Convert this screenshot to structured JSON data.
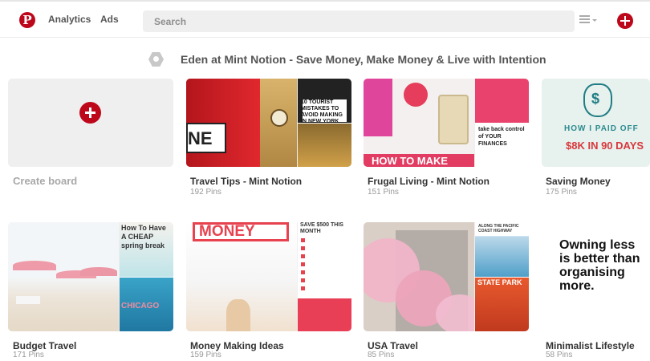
{
  "header": {
    "logo": "P",
    "nav": [
      "Analytics",
      "Ads"
    ],
    "search_placeholder": "Search"
  },
  "profile": {
    "title": "Eden at Mint Notion - Save Money, Make Money & Live with Intention"
  },
  "create_board": {
    "label": "Create board"
  },
  "boards": [
    {
      "title": "Travel Tips - Mint Notion",
      "count": "192 Pins",
      "cover": "NE",
      "side_top": "10 TOURIST MISTAKES TO AVOID MAKING IN NEW YORK CITY"
    },
    {
      "title": "Frugal Living - Mint Notion",
      "count": "151 Pins",
      "cover": "HOW TO MAKE",
      "side_bot": "take back control of YOUR FINANCES"
    },
    {
      "title": "Saving Money",
      "count": "175 Pins",
      "cover_line1": "HOW I PAID OFF",
      "cover_line2": "$8K IN 90 DAYS"
    },
    {
      "title": "Budget Travel",
      "count": "171 Pins",
      "side_top": "How To Have A CHEAP spring break",
      "side_bot": "CHICAGO"
    },
    {
      "title": "Money Making Ideas",
      "count": "159 Pins",
      "cover": "MONEY",
      "side_top": "SAVE $500 THIS MONTH"
    },
    {
      "title": "USA Travel",
      "count": "85 Pins",
      "side_top": "ALONG THE PACIFIC COAST HIGHWAY",
      "side_bot": "STATE PARK"
    },
    {
      "title": "Minimalist Lifestyle",
      "count": "58 Pins",
      "cover": "Owning less is better than organising more."
    }
  ],
  "colors": {
    "brand": "#bd081c"
  }
}
